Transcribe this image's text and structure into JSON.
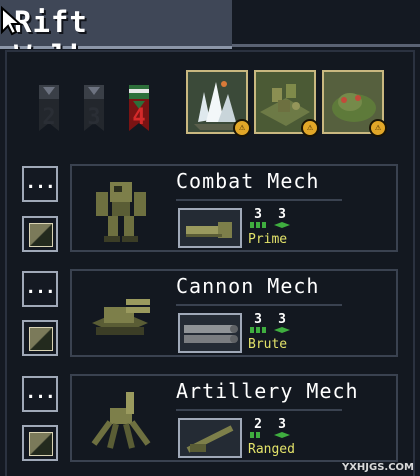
{
  "squad": {
    "title": "Rift Walkers"
  },
  "flags": [
    {
      "label": "2",
      "color": "#3a3f47"
    },
    {
      "label": "3",
      "color": "#3a3f47"
    },
    {
      "label": "4",
      "color": "#d42a2a"
    }
  ],
  "achievements": [
    {
      "icon": "crystal-spikes-icon"
    },
    {
      "icon": "mech-cluster-icon"
    },
    {
      "icon": "vek-creature-icon"
    }
  ],
  "mechs": [
    {
      "name": "Combat Mech",
      "move": "3",
      "health": "3",
      "class": "Prime",
      "weapon_icon": "titan-fist-icon"
    },
    {
      "name": "Cannon Mech",
      "move": "3",
      "health": "3",
      "class": "Brute",
      "weapon_icon": "taurus-cannon-icon"
    },
    {
      "name": "Artillery Mech",
      "move": "2",
      "health": "3",
      "class": "Ranged",
      "weapon_icon": "artemis-artillery-icon"
    }
  ],
  "buttons": {
    "more": "...",
    "palette": ""
  },
  "watermark": "YXHJGS.COM",
  "colors": {
    "class_text": "#e3e36a",
    "stat_green": "#3fae3f",
    "coin": "#e2a728"
  }
}
